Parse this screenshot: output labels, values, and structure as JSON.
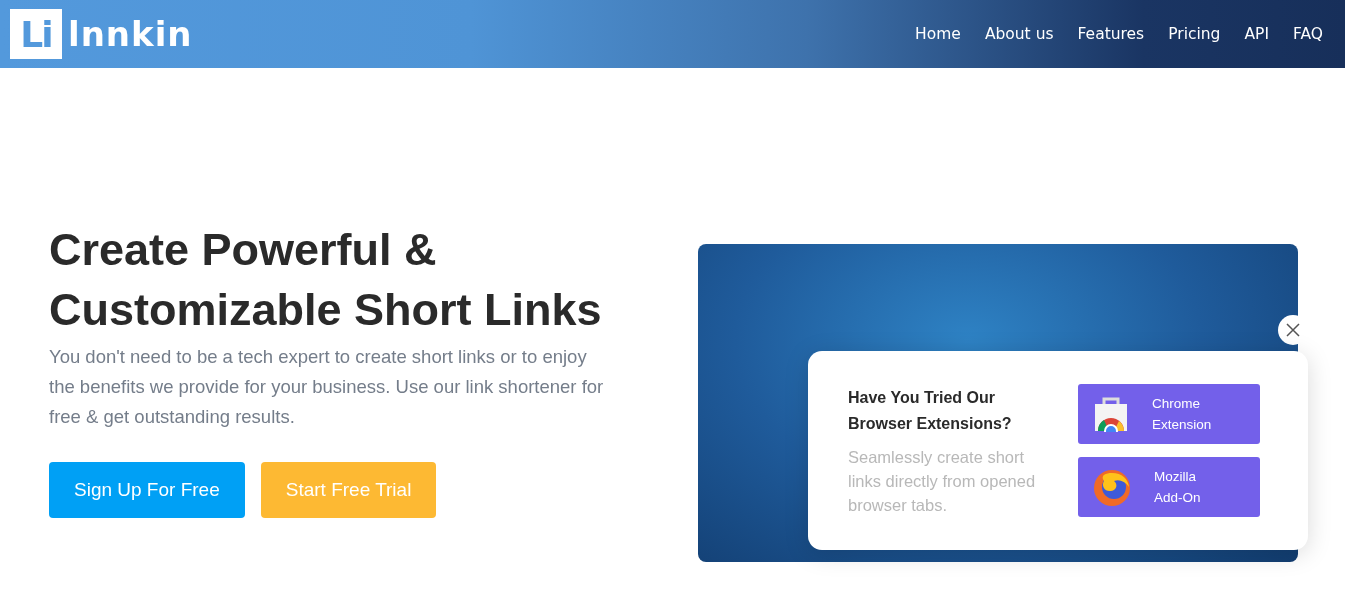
{
  "header": {
    "logo_mark": "Li",
    "logo_text": "lnnkin",
    "nav": [
      {
        "label": "Home"
      },
      {
        "label": "About us"
      },
      {
        "label": "Features"
      },
      {
        "label": "Pricing"
      },
      {
        "label": "API"
      },
      {
        "label": "FAQ"
      }
    ]
  },
  "hero": {
    "title": "Create Powerful & Customizable Short Links",
    "text": "You don't need to be a tech expert to create short links or to enjoy the benefits we provide for your business. Use our link shortener for free & get outstanding results.",
    "buttons": [
      {
        "label": "Sign Up For Free",
        "kind": "primary"
      },
      {
        "label": "Start Free Trial",
        "kind": "secondary"
      }
    ]
  },
  "popup": {
    "title": "Have You Tried Our Browser Extensions?",
    "text": "Seamlessly create short links directly from opened browser tabs.",
    "extensions": [
      {
        "kind": "chrome",
        "line1": "Chrome",
        "line2": "Extension"
      },
      {
        "kind": "firefox",
        "line1": "Mozilla",
        "line2": "Add-On"
      }
    ]
  }
}
